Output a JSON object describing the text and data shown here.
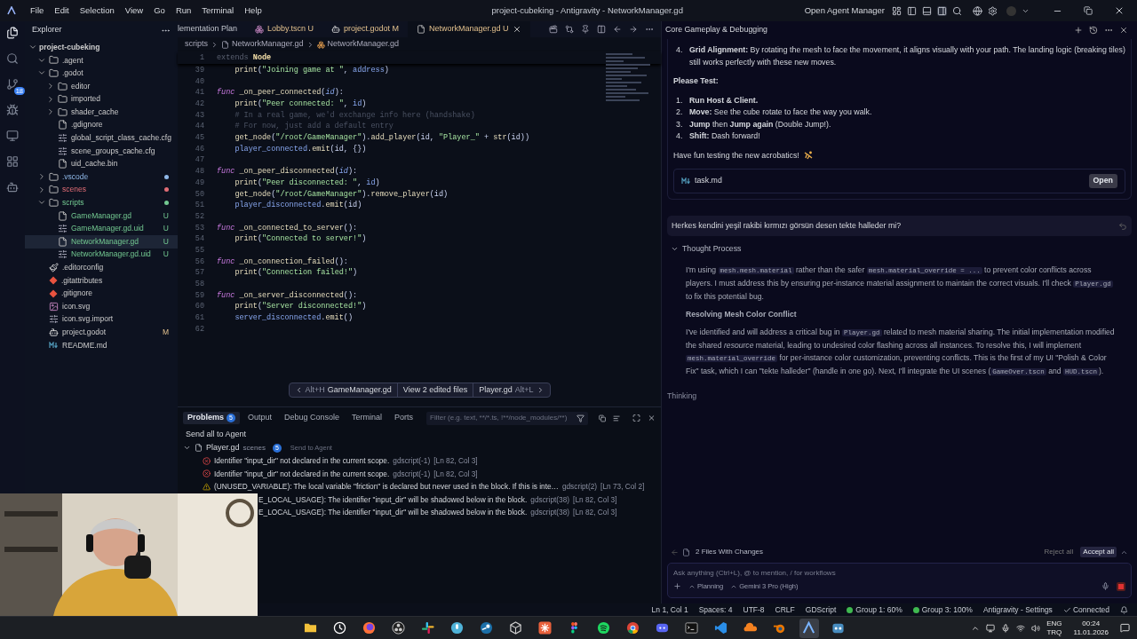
{
  "window": {
    "title": "project-cubeking - Antigravity - NetworkManager.gd",
    "menus": [
      "File",
      "Edit",
      "Selection",
      "View",
      "Go",
      "Run",
      "Terminal",
      "Help"
    ],
    "agent_manager": "Open Agent Manager"
  },
  "activity_bar": [
    {
      "kind": "files",
      "selected": true
    },
    {
      "kind": "search",
      "selected": false
    },
    {
      "kind": "source-control",
      "selected": false,
      "badge": "18"
    },
    {
      "kind": "run",
      "selected": false
    },
    {
      "kind": "remote",
      "selected": false
    },
    {
      "kind": "extensions",
      "selected": false
    },
    {
      "kind": "robot",
      "selected": false
    }
  ],
  "sidebar": {
    "title": "Explorer",
    "tree": [
      {
        "name": "project-cubeking",
        "kind": "root",
        "expanded": true,
        "selected": false,
        "children": [
          {
            "name": ".agent",
            "kind": "folder",
            "expanded": true,
            "selected": false
          },
          {
            "name": ".godot",
            "kind": "folder",
            "expanded": true,
            "selected": false,
            "children": [
              {
                "name": "editor",
                "kind": "folder",
                "expanded": false,
                "selected": false
              },
              {
                "name": "imported",
                "kind": "folder",
                "expanded": false,
                "selected": false
              },
              {
                "name": "shader_cache",
                "kind": "folder",
                "expanded": false,
                "selected": false
              },
              {
                "name": ".gdignore",
                "kind": "file",
                "selected": false
              },
              {
                "name": "global_script_class_cache.cfg",
                "kind": "config-file",
                "selected": false
              },
              {
                "name": "scene_groups_cache.cfg",
                "kind": "config-file",
                "selected": false
              },
              {
                "name": "uid_cache.bin",
                "kind": "file",
                "selected": false
              }
            ]
          },
          {
            "name": ".vscode",
            "kind": "folder",
            "expanded": false,
            "selected": false,
            "color": "#8fb8e8"
          },
          {
            "name": "scenes",
            "kind": "folder",
            "expanded": false,
            "selected": false,
            "color": "#e06c75"
          },
          {
            "name": "scripts",
            "kind": "folder",
            "expanded": true,
            "selected": false,
            "color": "#73c991",
            "children": [
              {
                "name": "GameManager.gd",
                "kind": "file",
                "selected": false,
                "status": "U"
              },
              {
                "name": "GameManager.gd.uid",
                "kind": "config-file",
                "selected": false,
                "status": "U"
              },
              {
                "name": "NetworkManager.gd",
                "kind": "file",
                "selected": true,
                "status": "U"
              },
              {
                "name": "NetworkManager.gd.uid",
                "kind": "config-file",
                "selected": false,
                "status": "U"
              }
            ]
          },
          {
            "name": ".editorconfig",
            "kind": "brush-file",
            "selected": false
          },
          {
            "name": ".gitattributes",
            "kind": "git-file",
            "selected": false
          },
          {
            "name": ".gitignore",
            "kind": "git-file",
            "selected": false
          },
          {
            "name": "icon.svg",
            "kind": "image-file",
            "selected": false
          },
          {
            "name": "icon.svg.import",
            "kind": "config-file",
            "selected": false
          },
          {
            "name": "project.godot",
            "kind": "godot-file",
            "selected": false,
            "status": "M"
          },
          {
            "name": "README.md",
            "kind": "markdown-file",
            "selected": false
          }
        ]
      }
    ]
  },
  "editor": {
    "tabs": [
      {
        "label": "lementation Plan",
        "kind": "doc",
        "selected": false
      },
      {
        "label": "Lobby.tscn",
        "status": "U",
        "kind": "scene",
        "selected": false
      },
      {
        "label": "project.godot",
        "status": "M",
        "kind": "godot",
        "selected": false
      },
      {
        "label": "NetworkManager.gd",
        "status": "U",
        "kind": "file",
        "selected": true
      }
    ],
    "breadcrumb": [
      "scripts",
      "NetworkManager.gd",
      "NetworkManager.gd"
    ],
    "sticky": {
      "number": "1",
      "indented": false,
      "tokens": [
        {
          "kind": "ext",
          "text": "extends "
        },
        {
          "kind": "cls",
          "text": "Node"
        }
      ]
    },
    "lines": [
      {
        "number": "39",
        "indented": true,
        "tokens": [
          {
            "kind": "fn",
            "text": "print"
          },
          {
            "kind": "pl",
            "text": "("
          },
          {
            "kind": "str",
            "text": "\"Joining game at \""
          },
          {
            "kind": "pl",
            "text": ", "
          },
          {
            "kind": "var",
            "text": "address"
          },
          {
            "kind": "pl",
            "text": ")"
          }
        ]
      },
      {
        "number": "40"
      },
      {
        "number": "41",
        "indented": false,
        "tokens": [
          {
            "kind": "kw",
            "text": "func "
          },
          {
            "kind": "fn",
            "text": "_on_peer_connected"
          },
          {
            "kind": "pl",
            "text": "("
          },
          {
            "kind": "param",
            "text": "id"
          },
          {
            "kind": "pl",
            "text": "):"
          }
        ]
      },
      {
        "number": "42",
        "indented": true,
        "tokens": [
          {
            "kind": "fn",
            "text": "print"
          },
          {
            "kind": "pl",
            "text": "("
          },
          {
            "kind": "str",
            "text": "\"Peer connected: \""
          },
          {
            "kind": "pl",
            "text": ", "
          },
          {
            "kind": "var",
            "text": "id"
          },
          {
            "kind": "pl",
            "text": ")"
          }
        ]
      },
      {
        "number": "43",
        "indented": true,
        "tokens": [
          {
            "kind": "cmt",
            "text": "# In a real game, we'd exchange info here (handshake)"
          }
        ]
      },
      {
        "number": "44",
        "indented": true,
        "tokens": [
          {
            "kind": "cmt",
            "text": "# For now, just add a default entry"
          }
        ]
      },
      {
        "number": "45",
        "indented": true,
        "tokens": [
          {
            "kind": "fn",
            "text": "get_node"
          },
          {
            "kind": "pl",
            "text": "("
          },
          {
            "kind": "str",
            "text": "\"/root/GameManager\""
          },
          {
            "kind": "pl",
            "text": ")."
          },
          {
            "kind": "fn",
            "text": "add_player"
          },
          {
            "kind": "pl",
            "text": "(id, "
          },
          {
            "kind": "str",
            "text": "\"Player_\""
          },
          {
            "kind": "pl",
            "text": " + "
          },
          {
            "kind": "fn",
            "text": "str"
          },
          {
            "kind": "pl",
            "text": "(id))"
          }
        ]
      },
      {
        "number": "46",
        "indented": true,
        "tokens": [
          {
            "kind": "var",
            "text": "player_connected"
          },
          {
            "kind": "pl",
            "text": "."
          },
          {
            "kind": "fn",
            "text": "emit"
          },
          {
            "kind": "pl",
            "text": "(id, {})"
          }
        ]
      },
      {
        "number": "47"
      },
      {
        "number": "48",
        "indented": false,
        "tokens": [
          {
            "kind": "kw",
            "text": "func "
          },
          {
            "kind": "fn",
            "text": "_on_peer_disconnected"
          },
          {
            "kind": "pl",
            "text": "("
          },
          {
            "kind": "param",
            "text": "id"
          },
          {
            "kind": "pl",
            "text": "):"
          }
        ]
      },
      {
        "number": "49",
        "indented": true,
        "tokens": [
          {
            "kind": "fn",
            "text": "print"
          },
          {
            "kind": "pl",
            "text": "("
          },
          {
            "kind": "str",
            "text": "\"Peer disconnected: \""
          },
          {
            "kind": "pl",
            "text": ", "
          },
          {
            "kind": "var",
            "text": "id"
          },
          {
            "kind": "pl",
            "text": ")"
          }
        ]
      },
      {
        "number": "50",
        "indented": true,
        "tokens": [
          {
            "kind": "fn",
            "text": "get_node"
          },
          {
            "kind": "pl",
            "text": "("
          },
          {
            "kind": "str",
            "text": "\"/root/GameManager\""
          },
          {
            "kind": "pl",
            "text": ")."
          },
          {
            "kind": "fn",
            "text": "remove_player"
          },
          {
            "kind": "pl",
            "text": "(id)"
          }
        ]
      },
      {
        "number": "51",
        "indented": true,
        "tokens": [
          {
            "kind": "var",
            "text": "player_disconnected"
          },
          {
            "kind": "pl",
            "text": "."
          },
          {
            "kind": "fn",
            "text": "emit"
          },
          {
            "kind": "pl",
            "text": "(id)"
          }
        ]
      },
      {
        "number": "52"
      },
      {
        "number": "53",
        "indented": false,
        "tokens": [
          {
            "kind": "kw",
            "text": "func "
          },
          {
            "kind": "fn",
            "text": "_on_connected_to_server"
          },
          {
            "kind": "pl",
            "text": "():"
          }
        ]
      },
      {
        "number": "54",
        "indented": true,
        "tokens": [
          {
            "kind": "fn",
            "text": "print"
          },
          {
            "kind": "pl",
            "text": "("
          },
          {
            "kind": "str",
            "text": "\"Connected to server!\""
          },
          {
            "kind": "pl",
            "text": ")"
          }
        ]
      },
      {
        "number": "55"
      },
      {
        "number": "56",
        "indented": false,
        "tokens": [
          {
            "kind": "kw",
            "text": "func "
          },
          {
            "kind": "fn",
            "text": "_on_connection_failed"
          },
          {
            "kind": "pl",
            "text": "():"
          }
        ]
      },
      {
        "number": "57",
        "indented": true,
        "tokens": [
          {
            "kind": "fn",
            "text": "print"
          },
          {
            "kind": "pl",
            "text": "("
          },
          {
            "kind": "str",
            "text": "\"Connection failed!\""
          },
          {
            "kind": "pl",
            "text": ")"
          }
        ]
      },
      {
        "number": "58"
      },
      {
        "number": "59",
        "indented": false,
        "tokens": [
          {
            "kind": "kw",
            "text": "func "
          },
          {
            "kind": "fn",
            "text": "_on_server_disconnected"
          },
          {
            "kind": "pl",
            "text": "():"
          }
        ]
      },
      {
        "number": "60",
        "indented": true,
        "tokens": [
          {
            "kind": "fn",
            "text": "print"
          },
          {
            "kind": "pl",
            "text": "("
          },
          {
            "kind": "str",
            "text": "\"Server disconnected!\""
          },
          {
            "kind": "pl",
            "text": ")"
          }
        ]
      },
      {
        "number": "61",
        "indented": true,
        "tokens": [
          {
            "kind": "var",
            "text": "server_disconnected"
          },
          {
            "kind": "pl",
            "text": "."
          },
          {
            "kind": "fn",
            "text": "emit"
          },
          {
            "kind": "pl",
            "text": "()"
          }
        ]
      },
      {
        "number": "62"
      }
    ],
    "navigator": {
      "prev_key": "Alt+H",
      "prev_file": "GameManager.gd",
      "middle": "View 2 edited files",
      "next_file": "Player.gd",
      "next_key": "Alt+L"
    }
  },
  "panel": {
    "tabs": [
      {
        "label": "Problems",
        "badge": "5",
        "selected": true
      },
      {
        "label": "Output",
        "selected": false
      },
      {
        "label": "Debug Console",
        "selected": false
      },
      {
        "label": "Terminal",
        "selected": false
      },
      {
        "label": "Ports",
        "selected": false
      }
    ],
    "filter": {
      "placeholder": "Filter (e.g. text, **/*.ts, !**/node_modules/**)"
    },
    "send_all": "Send all to Agent",
    "group": {
      "file": "Player.gd",
      "folder": "scenes",
      "count": "5",
      "action": "Send to Agent",
      "expanded": true
    },
    "problems": [
      {
        "kind": "error",
        "message": "Identifier \"input_dir\" not declared in the current scope.",
        "source": "gdscript(-1)",
        "location": "[Ln 82, Col 3]"
      },
      {
        "kind": "error",
        "message": "Identifier \"input_dir\" not declared in the current scope.",
        "source": "gdscript(-1)",
        "location": "[Ln 82, Col 3]"
      },
      {
        "kind": "warning",
        "message": "(UNUSED_VARIABLE): The local variable \"friction\" is declared but never used in the block. If this is inte…",
        "source": "gdscript(2)",
        "location": "[Ln 73, Col 2]"
      },
      {
        "message": "E_LOCAL_USAGE): The identifier \"input_dir\" will be shadowed below in the block.",
        "source": "gdscript(38)",
        "location": "[Ln 82, Col 3]"
      },
      {
        "message": "E_LOCAL_USAGE): The identifier \"input_dir\" will be shadowed below in the block.",
        "source": "gdscript(38)",
        "location": "[Ln 82, Col 3]"
      }
    ]
  },
  "agent": {
    "title": "Core Gameplay & Debugging",
    "response": [
      {
        "kind": "list",
        "items": [
          {
            "number": "4.",
            "text": "**Grid Alignment:** By rotating the mesh to face the movement, it aligns visually with your path. The landing logic (breaking tiles) still works perfectly with these new moves."
          }
        ]
      },
      {
        "kind": "heading",
        "text": "Please Test:"
      },
      {
        "kind": "list",
        "items": [
          {
            "number": "1.",
            "text": "**Run Host & Client.**"
          },
          {
            "number": "2.",
            "text": "**Move:** See the cube rotate to face the way you walk."
          },
          {
            "number": "3.",
            "text": "**Jump** then **Jump again** (Double Jump!)."
          },
          {
            "number": "4.",
            "text": "**Shift:** Dash forward!"
          }
        ]
      },
      {
        "kind": "closing",
        "text": "Have fun testing the new acrobatics!"
      }
    ],
    "file_card": {
      "name": "task.md",
      "button": "Open"
    },
    "user_message": "Herkes kendini yeşil rakibi kırmızı görsün desen tekte halleder mi?",
    "thought": {
      "title": "Thought Process",
      "expanded": true,
      "blocks": [
        {
          "kind": "paragraph",
          "segments": [
            {
              "text": "I'm using ",
              "code": false
            },
            {
              "text": "mesh.mesh.material",
              "code": true
            },
            {
              "text": " rather than the safer ",
              "code": false
            },
            {
              "text": "mesh.material_override = ...",
              "code": true
            },
            {
              "text": " to prevent color conflicts across players. I must address this by ensuring per-instance material assignment to maintain the correct visuals. I'll check ",
              "code": false
            },
            {
              "text": "Player.gd",
              "code": true
            },
            {
              "text": " to fix this potential bug.",
              "code": false
            }
          ]
        },
        {
          "kind": "heading",
          "text": "Resolving Mesh Color Conflict"
        },
        {
          "kind": "paragraph",
          "segments": [
            {
              "text": "I've identified and will address a critical bug in ",
              "code": false
            },
            {
              "text": "Player.gd",
              "code": true
            },
            {
              "text": " related to mesh material sharing. The initial implementation modified the shared *resource* material, leading to undesired color flashing across all instances. To resolve this, I will implement ",
              "code": false
            },
            {
              "text": "mesh.material_override",
              "code": true
            },
            {
              "text": " for per-instance color customization, preventing conflicts. This is the first of my UI \"Polish & Color Fix\" task, which I can \"tekte halleder\" (handle in one go). Next, I'll integrate the UI scenes (",
              "code": false
            },
            {
              "text": "GameOver.tscn",
              "code": true
            },
            {
              "text": " and ",
              "code": false
            },
            {
              "text": "HUD.tscn",
              "code": true
            },
            {
              "text": ").",
              "code": false
            }
          ]
        }
      ]
    },
    "status": "Thinking",
    "changes": {
      "label": "2 Files With Changes",
      "reject": "Reject all",
      "accept": "Accept all"
    },
    "input": {
      "placeholder": "Ask anything (Ctrl+L), @ to mention, / for workflows",
      "mode": "Planning",
      "model": "Gemini 3 Pro (High)"
    }
  },
  "status_bar": {
    "items": [
      "Ln 1, Col 1",
      "Spaces: 4",
      "UTF-8",
      "CRLF",
      "GDScript"
    ],
    "groups": [
      {
        "label": "Group 1: 60%",
        "color": "#3fb950"
      },
      {
        "label": "Group 3: 100%",
        "color": "#3fb950"
      }
    ],
    "settings": "Antigravity - Settings",
    "connection": "Connected"
  },
  "taskbar": {
    "apps": [
      {
        "kind": "folder",
        "selected": false
      },
      {
        "kind": "clock",
        "selected": false
      },
      {
        "kind": "fox",
        "selected": false
      },
      {
        "kind": "record",
        "selected": false
      },
      {
        "kind": "hash",
        "selected": false
      },
      {
        "kind": "mic",
        "selected": false
      },
      {
        "kind": "steam",
        "selected": false
      },
      {
        "kind": "cube",
        "selected": false
      },
      {
        "kind": "burst",
        "selected": false
      },
      {
        "kind": "figma",
        "selected": false
      },
      {
        "kind": "music",
        "selected": false
      },
      {
        "kind": "chrome",
        "selected": false
      },
      {
        "kind": "chat",
        "selected": false
      },
      {
        "kind": "terminal",
        "selected": false
      },
      {
        "kind": "code",
        "selected": false
      },
      {
        "kind": "cloud",
        "selected": false
      },
      {
        "kind": "blender",
        "selected": false
      },
      {
        "kind": "agent",
        "selected": true
      },
      {
        "kind": "robot",
        "selected": false
      }
    ],
    "language": [
      "ENG",
      "TRQ"
    ],
    "time": "00:24",
    "date": "11.01.2026"
  }
}
